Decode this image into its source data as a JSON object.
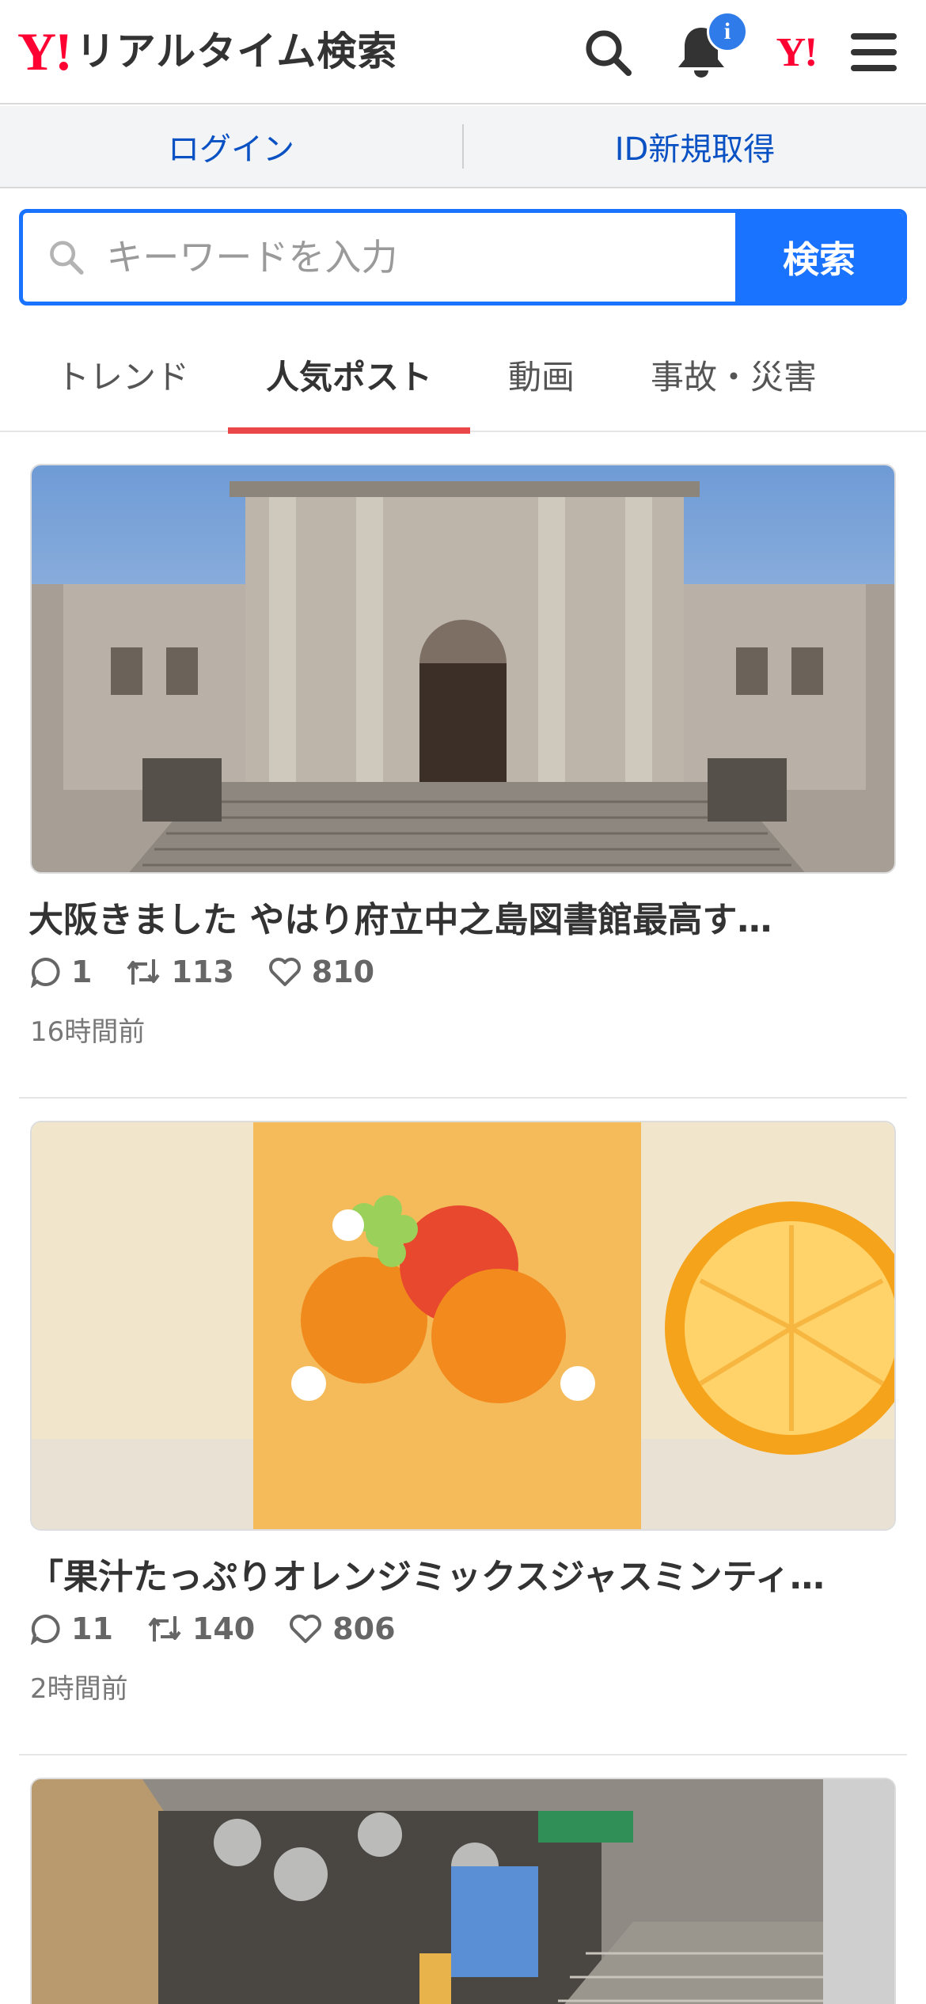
{
  "header": {
    "logo_mark": "Y!",
    "logo_text": "リアルタイム検索",
    "notification_badge": "i",
    "yahoo_mini": "Y!",
    "icons": [
      "search-icon",
      "bell-icon",
      "yahoo-icon",
      "menu-icon"
    ]
  },
  "auth": {
    "login": "ログイン",
    "register": "ID新規取得"
  },
  "search": {
    "placeholder": "キーワードを入力",
    "button": "検索"
  },
  "tabs": [
    {
      "label": "トレンド",
      "active": false
    },
    {
      "label": "人気ポスト",
      "active": true
    },
    {
      "label": "動画",
      "active": false
    },
    {
      "label": "事故・災害",
      "active": false
    }
  ],
  "posts": [
    {
      "title": "大阪きました󠄀 やはり府立中之島図書館最高す…",
      "replies": "1",
      "reposts": "113",
      "likes": "810",
      "time": "16時間前",
      "image": "library-photo"
    },
    {
      "title": "「果汁たっぷりオレンジミックスジャスミンティ…",
      "replies": "11",
      "reposts": "140",
      "likes": "806",
      "time": "2時間前",
      "image": "orange-drink-photo"
    },
    {
      "image": "zoo-entrance-photo"
    }
  ],
  "colors": {
    "brand_red": "#ff0033",
    "accent_blue": "#1a73ff",
    "tab_underline": "#e9474a",
    "link_blue": "#0a52c4"
  }
}
